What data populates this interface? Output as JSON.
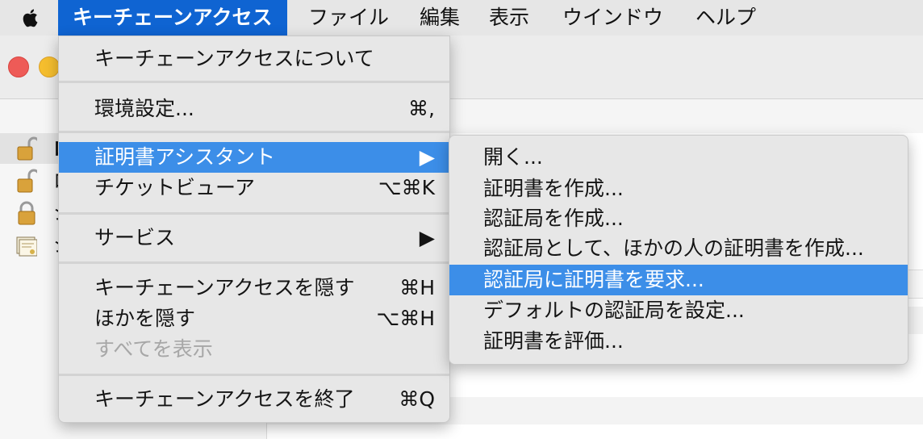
{
  "menubar": {
    "items": [
      {
        "label": "キーチェーンアクセス",
        "active": true
      },
      {
        "label": "ファイル"
      },
      {
        "label": "編集"
      },
      {
        "label": "表示"
      },
      {
        "label": "ウインドウ"
      },
      {
        "label": "ヘルプ"
      }
    ]
  },
  "main_menu": {
    "items": [
      {
        "label": "キーチェーンアクセスについて",
        "shortcut": ""
      },
      {
        "label": "環境設定...",
        "shortcut": "⌘,"
      },
      {
        "label": "証明書アシスタント",
        "shortcut": "▶",
        "highlighted": true,
        "submenu": true
      },
      {
        "label": "チケットビューア",
        "shortcut": "⌥⌘K"
      },
      {
        "label": "サービス",
        "shortcut": "▶",
        "submenu": true
      },
      {
        "label": "キーチェーンアクセスを隠す",
        "shortcut": "⌘H"
      },
      {
        "label": "ほかを隠す",
        "shortcut": "⌥⌘H"
      },
      {
        "label": "すべてを表示",
        "shortcut": "",
        "disabled": true
      },
      {
        "label": "キーチェーンアクセスを終了",
        "shortcut": "⌘Q"
      }
    ]
  },
  "sub_menu": {
    "items": [
      {
        "label": "開く..."
      },
      {
        "label": "証明書を作成..."
      },
      {
        "label": "認証局を作成..."
      },
      {
        "label": "認証局として、ほかの人の証明書を作成..."
      },
      {
        "label": "認証局に証明書を要求...",
        "highlighted": true
      },
      {
        "label": "デフォルトの認証局を設定..."
      },
      {
        "label": "証明書を評価..."
      }
    ]
  },
  "sidebar": {
    "items": [
      {
        "label": "ロ",
        "icon": "unlocked-padlock-icon",
        "selected": true
      },
      {
        "label": "ロ",
        "icon": "unlocked-padlock-icon"
      },
      {
        "label": "シ",
        "icon": "locked-padlock-icon"
      },
      {
        "label": "シ",
        "icon": "certificate-icon"
      }
    ]
  },
  "colors": {
    "menubar_active": "#0f64d2",
    "menu_highlight": "#3c8ee8",
    "traffic_close": "#ee5b57",
    "traffic_minimize": "#f5be2e"
  }
}
